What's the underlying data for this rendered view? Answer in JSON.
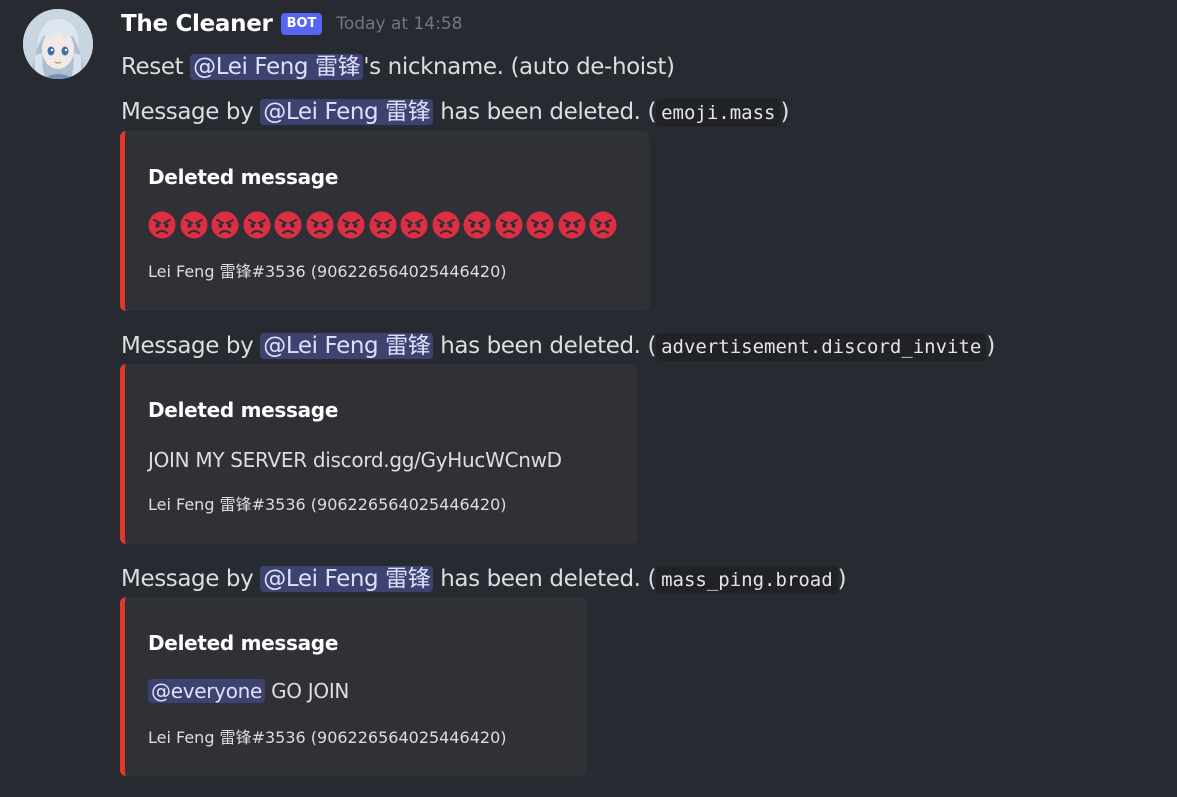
{
  "message": {
    "author": "The Cleaner",
    "badge": "BOT",
    "timestamp": "Today at 14:58",
    "avatar_icon": "anime-avatar-icon"
  },
  "reset_line": {
    "prefix": "Reset ",
    "mention": "@Lei Feng 雷锋",
    "suffix": "'s nickname. (auto de-hoist)"
  },
  "deletions": [
    {
      "prefix": "Message by ",
      "mention": "@Lei Feng 雷锋",
      "middle": " has been deleted. (",
      "reason": "emoji.mass",
      "close": ")",
      "embed": {
        "title": "Deleted message",
        "emoji_name": "angry-face-icon",
        "emoji_count": 15,
        "footer": "Lei Feng 雷锋#3536 (906226564025446420)"
      }
    },
    {
      "prefix": "Message by ",
      "mention": "@Lei Feng 雷锋",
      "middle": " has been deleted. (",
      "reason": "advertisement.discord_invite",
      "close": ")",
      "embed": {
        "title": "Deleted message",
        "content": "JOIN MY SERVER discord.gg/GyHucWCnwD",
        "footer": "Lei Feng 雷锋#3536 (906226564025446420)"
      }
    },
    {
      "prefix": "Message by ",
      "mention": "@Lei Feng 雷锋",
      "middle": " has been deleted. (",
      "reason": "mass_ping.broad",
      "close": ")",
      "embed": {
        "title": "Deleted message",
        "content_mention": "@everyone",
        "content": " GO JOIN",
        "footer": "Lei Feng 雷锋#3536 (906226564025446420)"
      }
    }
  ],
  "colors": {
    "background": "#272a30",
    "embed_background": "#2f3136",
    "embed_border": "#e0392c",
    "mention_bg": "#3d4270",
    "badge": "#5865f2"
  }
}
